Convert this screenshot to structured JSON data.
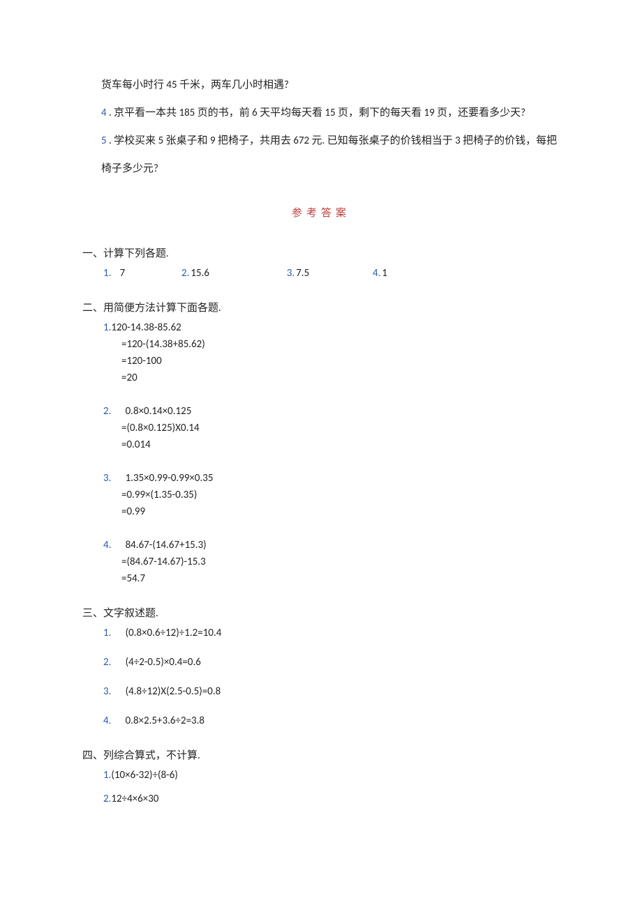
{
  "top": {
    "line1": "货车每小时行 45 千米，两车几小时相遇?",
    "q4_num": "4",
    "q4_text": " . 京平看一本共 185 页的书，前 6 天平均每天看 15 页，剩下的每天看 19 页，还要看多少天?",
    "q5_num": "5",
    "q5_text_a": " . 学校买来 5 张桌子和 9 把椅子，共用去 672 元. 已知每张桌子的价钱相当于 3 把椅子的价钱，每把",
    "q5_text_b": "椅子多少元?"
  },
  "answers_title": "参考答案",
  "s1": {
    "head": "一、计算下列各题.",
    "n1": "1.",
    "v1": "7",
    "n2": "2.",
    "v2": "15.6",
    "n3": "3.",
    "v3": "7.5",
    "n4": "4.",
    "v4": "1"
  },
  "s2": {
    "head": "二、用简便方法计算下面各题.",
    "b1": {
      "first_num": "1.",
      "first_expr": "120-14.38-85.62",
      "l2": "=120-(14.38+85.62)",
      "l3": "=120-100",
      "l4": "=20"
    },
    "b2": {
      "first_num": "2.",
      "first_expr": "0.8×0.14×0.125",
      "l2": "=(0.8×0.125)X0.14",
      "l3": "=0.014"
    },
    "b3": {
      "first_num": "3.",
      "first_expr": "1.35×0.99-0.99×0.35",
      "l2": "=0.99×(1.35-0.35)",
      "l3": "=0.99"
    },
    "b4": {
      "first_num": "4.",
      "first_expr": "84.67-(14.67+15.3)",
      "l2": "=(84.67-14.67)-15.3",
      "l3": "=54.7"
    }
  },
  "s3": {
    "head": "三、文字叙述题.",
    "r1_num": "1.",
    "r1": "(0.8×0.6÷12)÷1.2=10.4",
    "r2_num": "2.",
    "r2": "(4÷2-0.5)×0.4=0.6",
    "r3_num": "3.",
    "r3": "(4.8÷12)X(2.5-0.5)=0.8",
    "r4_num": "4.",
    "r4": "0.8×2.5+3.6÷2=3.8"
  },
  "s4": {
    "head": "四、列综合算式，不计算.",
    "r1_num": "1.",
    "r1": "(10×6-32)÷(8-6)",
    "r2_num": "2.",
    "r2": "12÷4×6×30"
  }
}
